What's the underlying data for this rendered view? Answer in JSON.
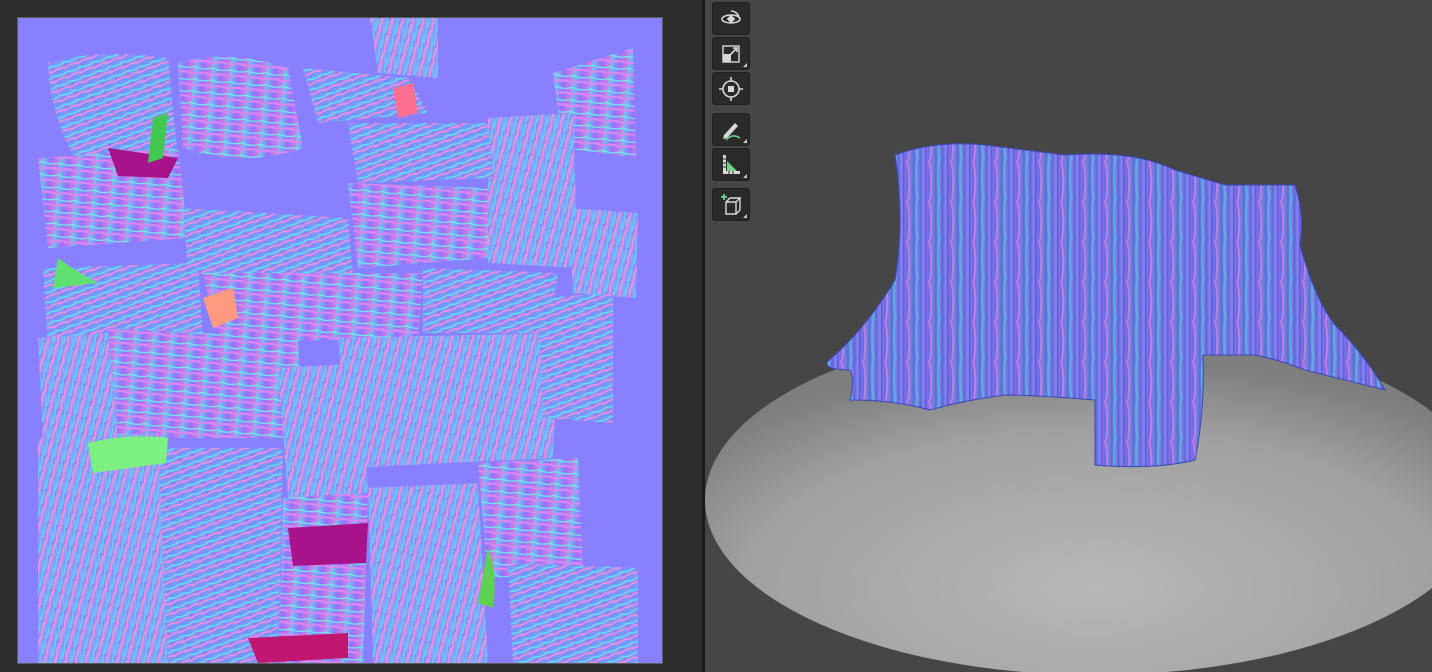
{
  "uv_editor": {
    "background_color": "#8880ff",
    "frame_color": "#5c5c5c"
  },
  "viewport": {
    "background_color": "#464646",
    "ground_color": "#a9a9a9"
  },
  "toolbar": {
    "tools": [
      {
        "icon": "orbit-icon"
      },
      {
        "icon": "scale-icon"
      },
      {
        "icon": "transform-center-icon"
      },
      {
        "icon": "draw-pencil-icon"
      },
      {
        "icon": "measure-icon"
      },
      {
        "icon": "add-cube-icon"
      }
    ]
  }
}
